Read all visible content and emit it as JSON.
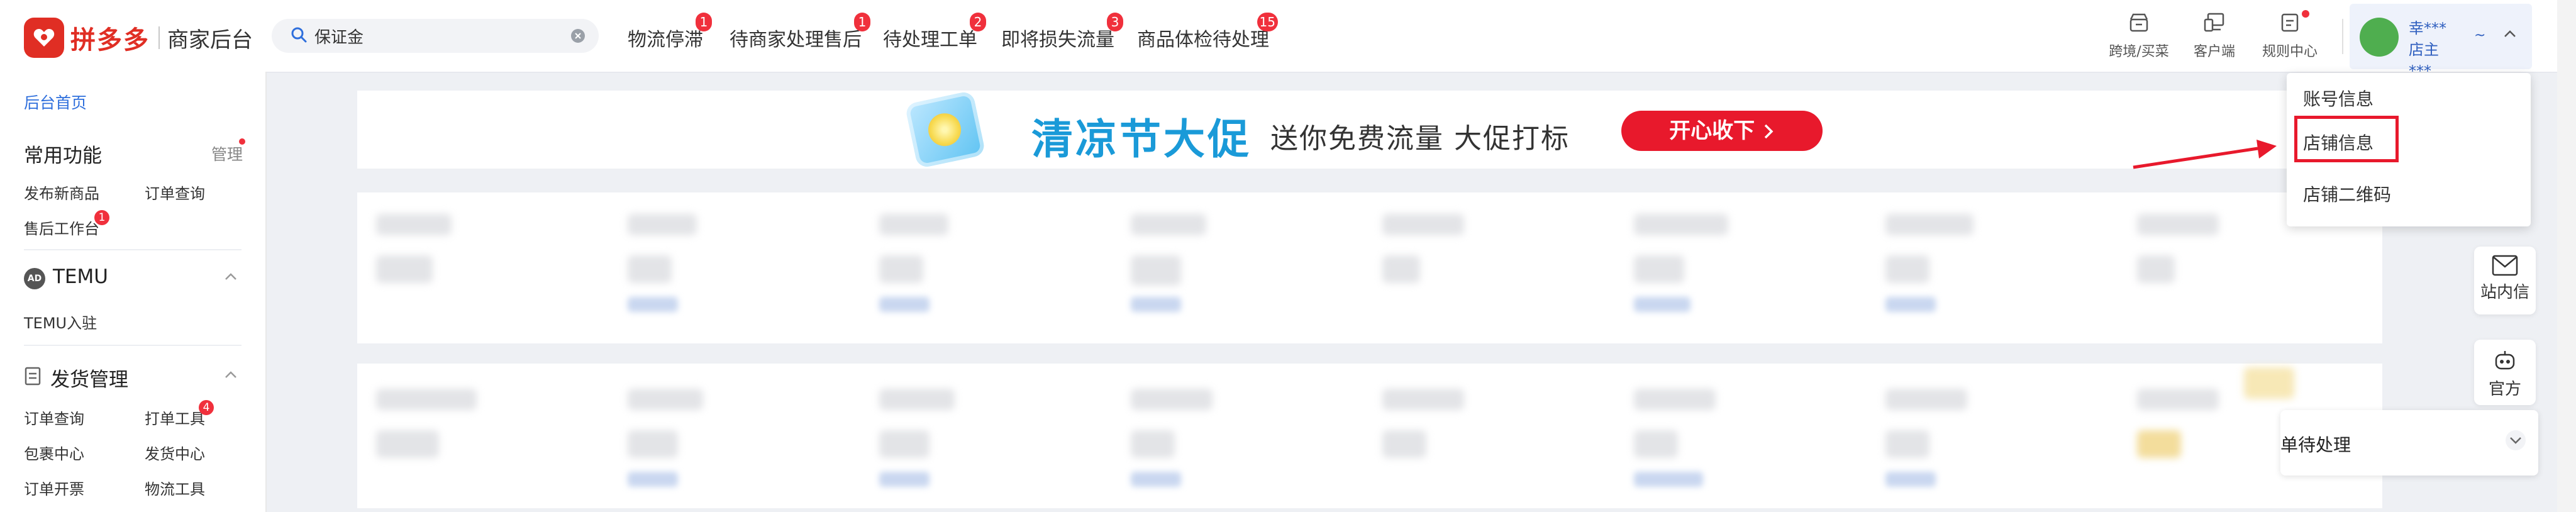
{
  "header": {
    "logo_name": "拼多多",
    "logo_sub": "商家后台",
    "search": {
      "value": "保证金"
    },
    "nav": [
      {
        "label": "物流停滞",
        "badge": "1"
      },
      {
        "label": "待商家处理售后",
        "badge": "1"
      },
      {
        "label": "待处理工单",
        "badge": "2"
      },
      {
        "label": "即将损失流量",
        "badge": "3"
      },
      {
        "label": "商品体检待处理",
        "badge": "15"
      }
    ],
    "tools": [
      {
        "label": "跨境/买菜",
        "icon": "store-icon"
      },
      {
        "label": "客户端",
        "icon": "desktop-icon"
      },
      {
        "label": "规则中心",
        "icon": "rules-icon"
      }
    ],
    "user": {
      "name": "幸***店主***",
      "extra": "~"
    }
  },
  "sidebar": {
    "home": "后台首页",
    "common": {
      "title": "常用功能",
      "manage": "管理"
    },
    "common_links": [
      "发布新商品",
      "订单查询",
      "售后工作台"
    ],
    "common_badge": "1",
    "temu": {
      "icon_text": "AD",
      "title": "TEMU",
      "link": "TEMU入驻"
    },
    "shipping": {
      "title": "发货管理",
      "links": [
        "订单查询",
        "打单工具",
        "包裹中心",
        "发货中心",
        "订单开票",
        "物流工具"
      ],
      "badge": "4"
    }
  },
  "banner": {
    "title": "清凉节大促",
    "subtitle": "送你免费流量 大促打标",
    "button": "开心收下"
  },
  "dropdown": {
    "items": [
      "账号信息",
      "店铺信息",
      "店铺二维码"
    ],
    "highlighted_index": 1
  },
  "right_rail": {
    "message": "站内信",
    "official": "官方"
  },
  "todo_panel": {
    "text": "单待处理"
  },
  "colors": {
    "brand": "#e02e24",
    "badge": "#f0303c",
    "link": "#2f6fdc",
    "banner_blue": "#1a9ad8",
    "banner_button": "#e8192c"
  }
}
